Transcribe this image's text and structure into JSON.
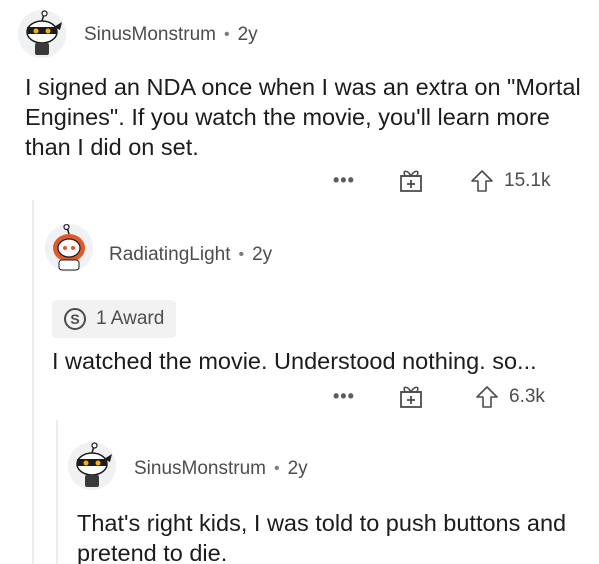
{
  "comments": [
    {
      "username": "SinusMonstrum",
      "separator": "•",
      "age": "2y",
      "body": "I signed an NDA once when I was an extra on \"Mortal Engines\". If you watch the movie, you'll learn more than I did on set.",
      "more_label": "•••",
      "upvotes": "15.1k",
      "avatar_icon": "snoo-ninja-avatar-icon"
    },
    {
      "username": "RadiatingLight",
      "separator": "•",
      "age": "2y",
      "award_label": "1 Award",
      "award_icon_letter": "S",
      "body": "I watched the movie. Understood nothing. so...",
      "more_label": "•••",
      "upvotes": "6.3k",
      "avatar_icon": "snoo-redhair-avatar-icon"
    },
    {
      "username": "SinusMonstrum",
      "separator": "•",
      "age": "2y",
      "body": "That's right kids, I was told to push buttons and pretend to die.",
      "avatar_icon": "snoo-ninja-avatar-icon"
    }
  ],
  "colors": {
    "text": "#1c1c1c",
    "meta": "#4d4d4d",
    "thread_line": "#ececec",
    "award_bg": "#f2f2f2",
    "hair": "#e0592a"
  }
}
